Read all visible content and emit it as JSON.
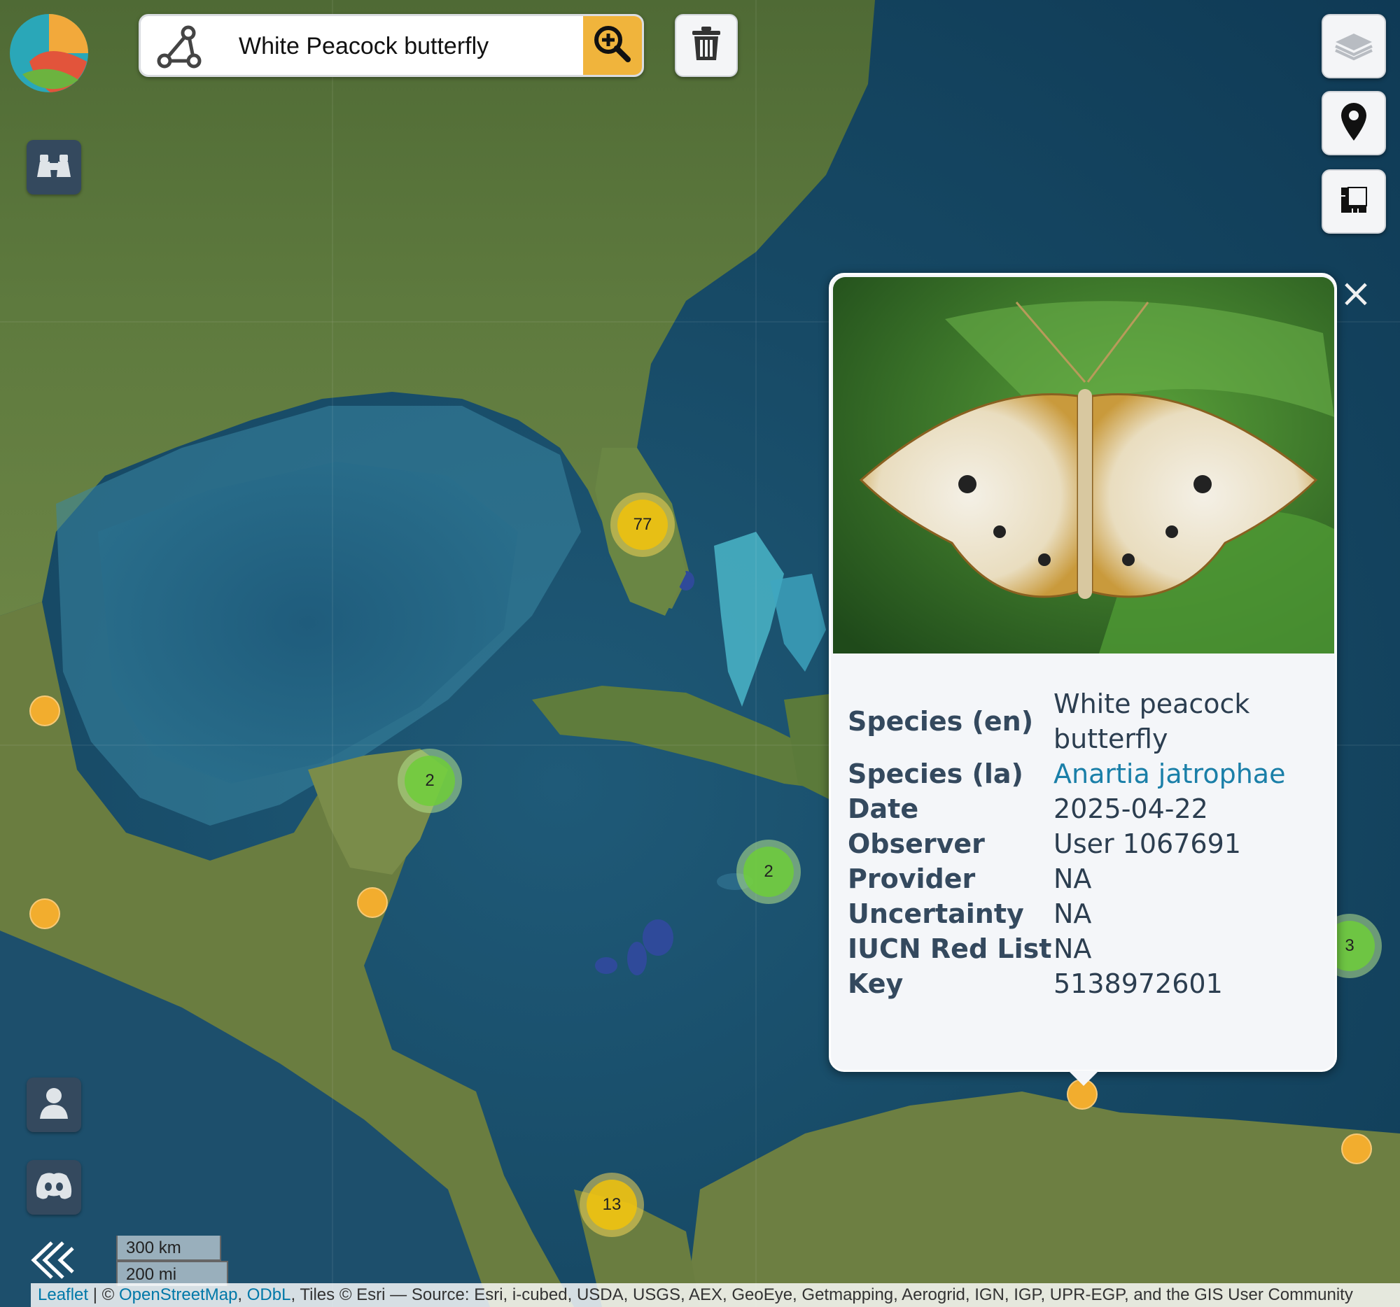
{
  "search": {
    "value": "White Peacock butterfly"
  },
  "clusters": [
    {
      "label": "77",
      "color": "yellow"
    },
    {
      "label": "2",
      "color": "green"
    },
    {
      "label": "2",
      "color": "green"
    },
    {
      "label": "3",
      "color": "green"
    },
    {
      "label": "13",
      "color": "yellow"
    }
  ],
  "popup": {
    "rows": [
      {
        "key": "Species (en)",
        "value": "White peacock butterfly"
      },
      {
        "key": "Species (la)",
        "value": "Anartia jatrophae"
      },
      {
        "key": "Date",
        "value": "2025-04-22"
      },
      {
        "key": "Observer",
        "value": "User 1067691"
      },
      {
        "key": "Provider",
        "value": "NA"
      },
      {
        "key": "Uncertainty",
        "value": "NA"
      },
      {
        "key": "IUCN Red List",
        "value": "NA"
      },
      {
        "key": "Key",
        "value": "5138972601"
      }
    ],
    "close_label": "×"
  },
  "scale": {
    "metric": "300 km",
    "imperial": "200 mi"
  },
  "attribution": {
    "leaflet": "Leaflet",
    "sep1": " | © ",
    "osm": "OpenStreetMap",
    "sep2": ", ",
    "odbl": "ODbL",
    "rest": ", Tiles © Esri — Source: Esri, i-cubed, USDA, USGS, AEX, GeoEye, Getmapping, Aerogrid, IGN, IGP, UPR-EGP, and the GIS User Community"
  },
  "icons": {
    "logo": "app-logo",
    "polygon": "polygon-draw-icon",
    "zoom_search": "zoom-in-search-icon",
    "trash": "trash-icon",
    "binoculars": "binoculars-icon",
    "layers": "layers-icon",
    "marker": "map-marker-icon",
    "ruler": "ruler-icon",
    "user": "user-icon",
    "discord": "discord-icon",
    "collapse": "double-chevron-left-icon"
  },
  "colors": {
    "accent": "#f0b43c",
    "panel_dark": "#34495e",
    "link": "#1a7fa8"
  }
}
